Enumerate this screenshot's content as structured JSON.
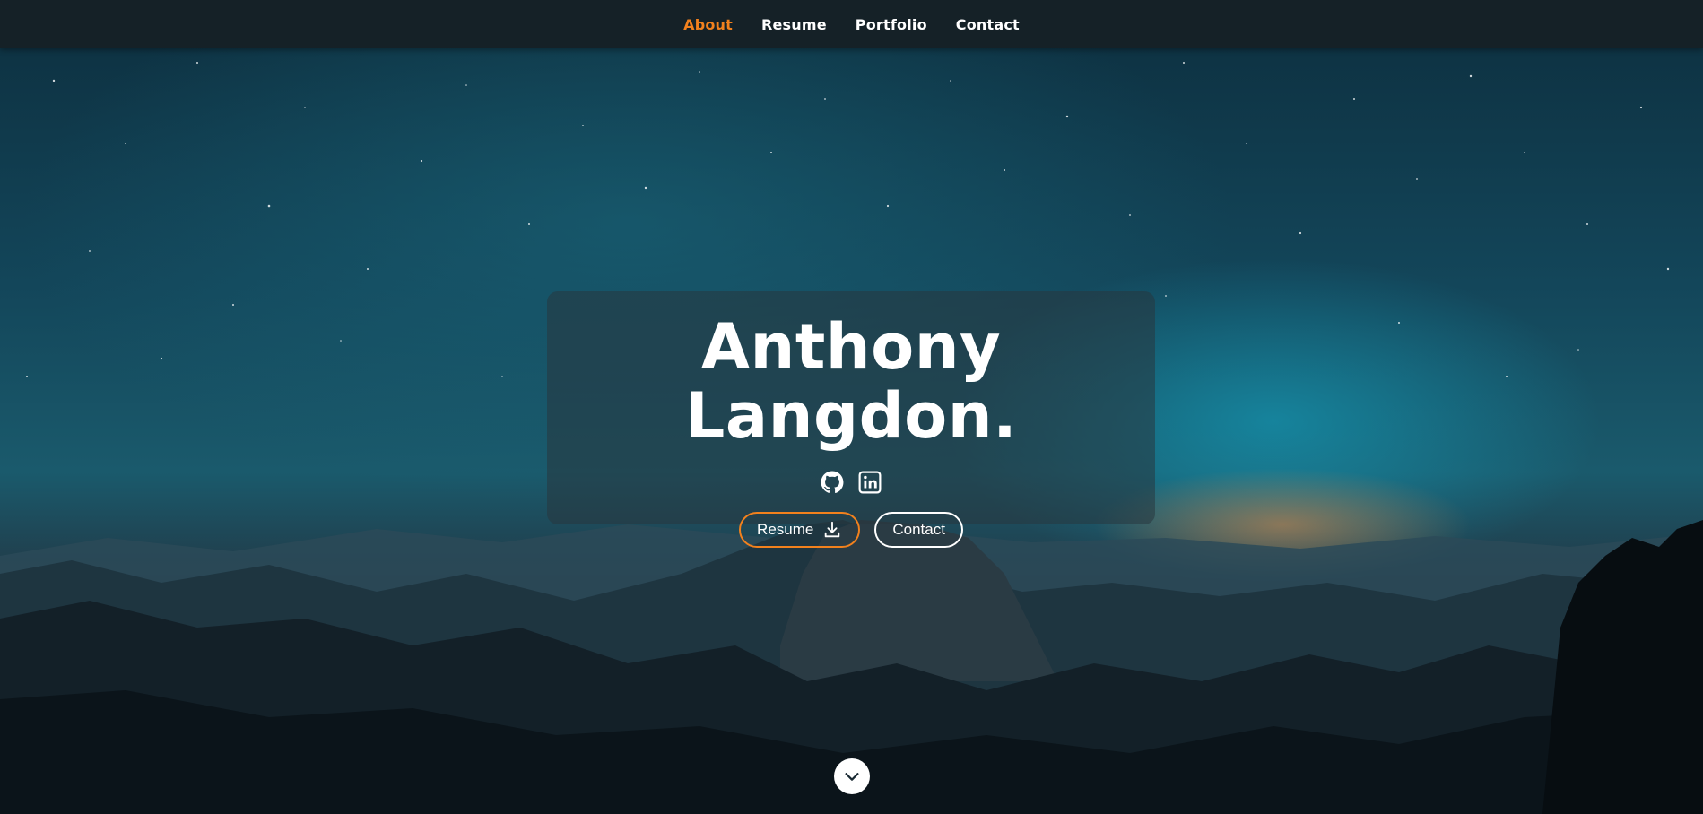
{
  "nav": {
    "items": [
      {
        "label": "About",
        "active": true
      },
      {
        "label": "Resume",
        "active": false
      },
      {
        "label": "Portfolio",
        "active": false
      },
      {
        "label": "Contact",
        "active": false
      }
    ]
  },
  "hero": {
    "title": "Anthony Langdon.",
    "socials": [
      "github-icon",
      "linkedin-icon"
    ],
    "resume_button": "Resume",
    "contact_button": "Contact"
  },
  "colors": {
    "accent": "#f2811d",
    "navbar": "#152127",
    "text": "#ffffff"
  }
}
